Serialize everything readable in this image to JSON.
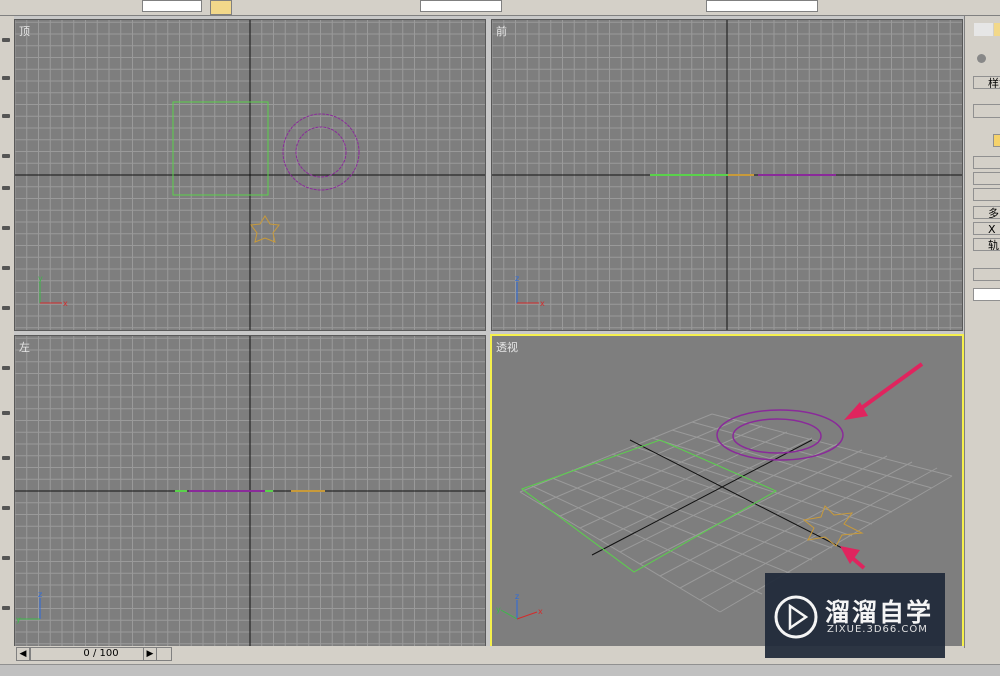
{
  "viewports": [
    {
      "key": "top",
      "label": "顶",
      "active": false
    },
    {
      "key": "front",
      "label": "前",
      "active": false
    },
    {
      "key": "left",
      "label": "左",
      "active": false
    },
    {
      "key": "perspective",
      "label": "透视",
      "active": true
    }
  ],
  "timeline": {
    "frame_text": "0 / 100",
    "prev_icon": "chevron-left-icon",
    "next_icon": "chevron-right-icon"
  },
  "command_panel": {
    "rows": [
      "样式",
      "多",
      "X",
      "轨"
    ]
  },
  "watermark": {
    "title": "溜溜自学",
    "url": "ZIXUE.3D66.COM"
  },
  "colors": {
    "viewport_bg": "#7e7e7e",
    "grid_line": "#9a9a9a",
    "axis_line": "#111111",
    "rectangle": "#5ad24b",
    "donut": "#8a2a9a",
    "star": "#c89a3a",
    "active_border": "#f5f04c",
    "arrow": "#e0245e"
  }
}
